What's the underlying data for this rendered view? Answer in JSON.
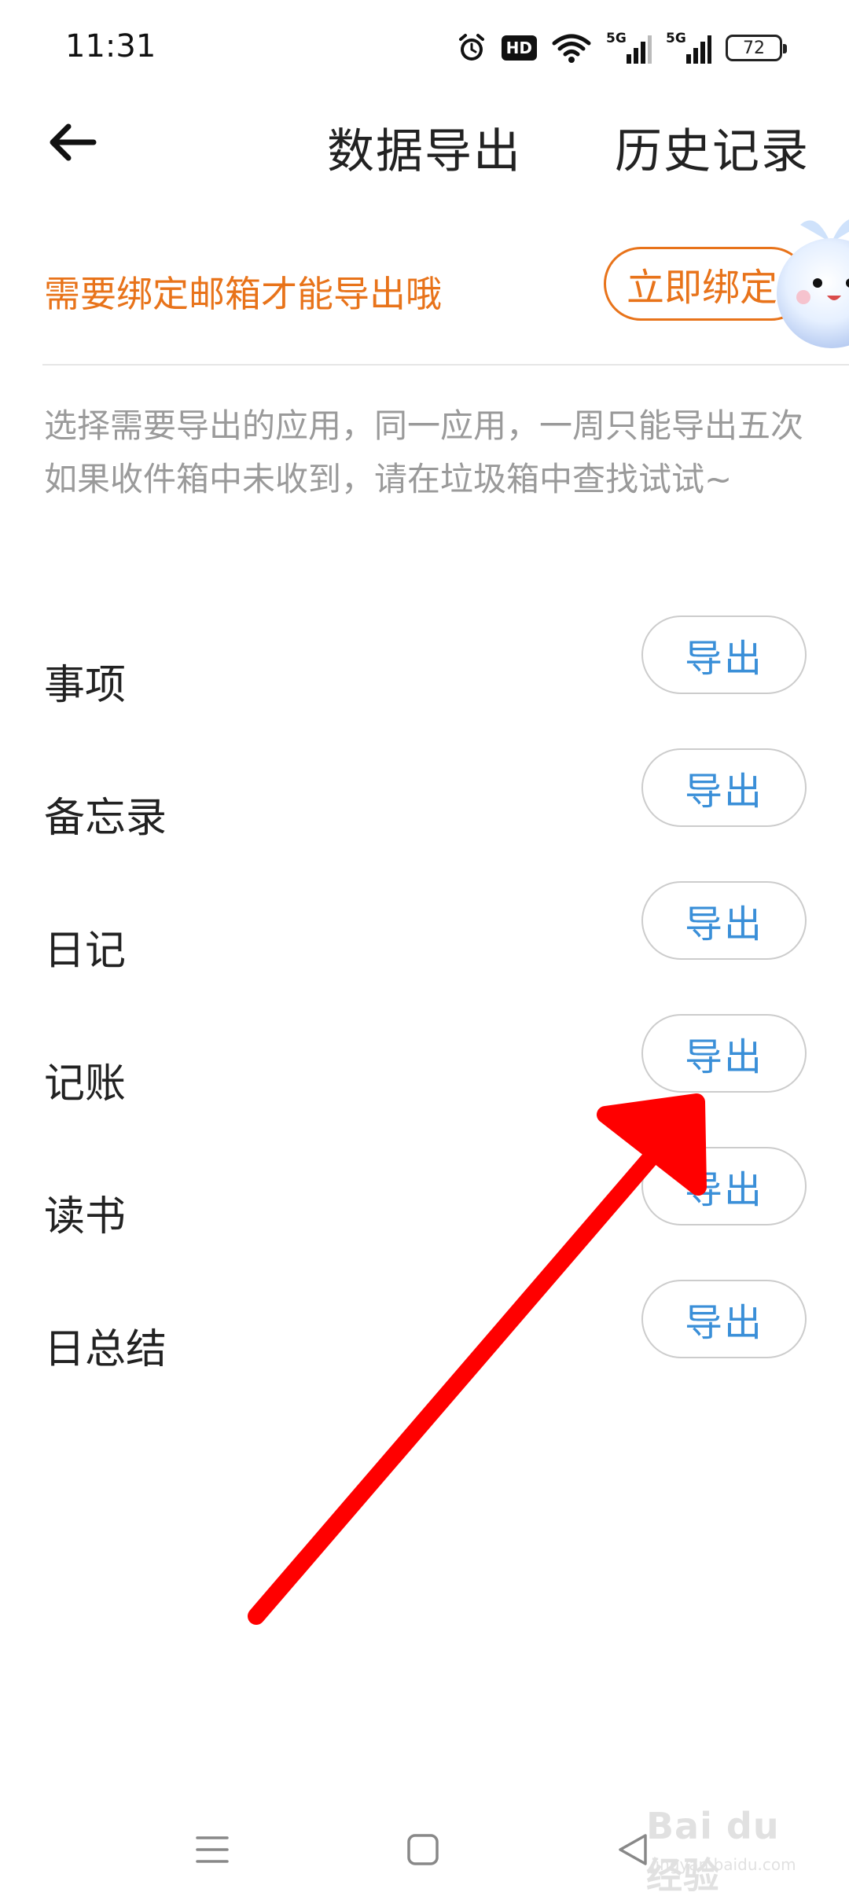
{
  "status_bar": {
    "time": "11:31",
    "battery": "72",
    "network_tag_1": "5G",
    "network_tag_2": "5G",
    "hd_tag": "HD",
    "icons": [
      "alarm-icon",
      "hd-icon",
      "wifi-icon",
      "signal-5g-icon",
      "signal-5g-icon",
      "battery-icon"
    ]
  },
  "header": {
    "back_icon": "back-arrow-icon",
    "title": "数据导出",
    "history_label": "历史记录"
  },
  "bind_banner": {
    "message": "需要绑定邮箱才能导出哦",
    "button_label": "立即绑定"
  },
  "description": {
    "line1": "选择需要导出的应用，同一应用，一周只能导出五次",
    "line2": "如果收件箱中未收到，请在垃圾箱中查找试试~"
  },
  "apps": [
    {
      "name": "事项",
      "button": "导出"
    },
    {
      "name": "备忘录",
      "button": "导出"
    },
    {
      "name": "日记",
      "button": "导出"
    },
    {
      "name": "记账",
      "button": "导出"
    },
    {
      "name": "读书",
      "button": "导出"
    },
    {
      "name": "日总结",
      "button": "导出"
    }
  ],
  "nav_bar": {
    "icons": [
      "menu-icon",
      "home-square-icon",
      "back-triangle-icon"
    ]
  },
  "watermark": {
    "main": "Bai du 经验",
    "sub": "jingyan.baidu.com"
  },
  "colors": {
    "accent_orange": "#E8731A",
    "link_blue": "#3A8FD8",
    "annotation_red": "#FF0000",
    "hint_gray": "#9a9a9a"
  }
}
